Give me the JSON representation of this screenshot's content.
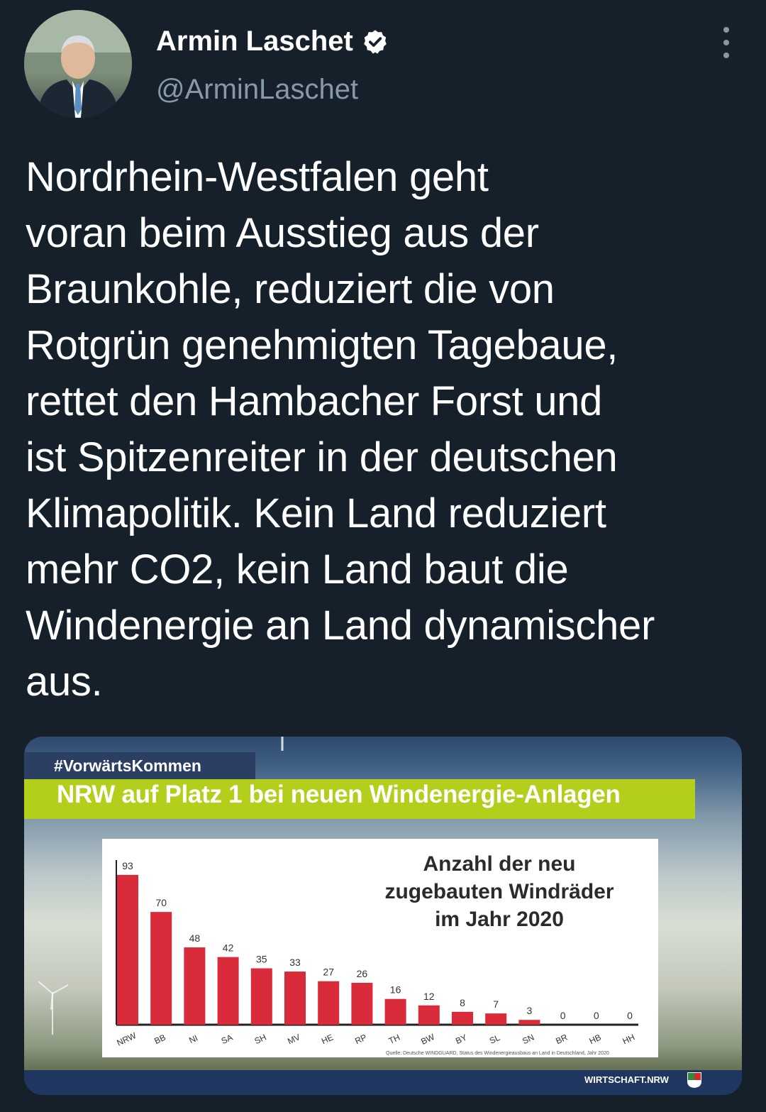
{
  "header": {
    "name": "Armin Laschet",
    "handle": "@ArminLaschet",
    "verified_icon": "verified-badge-icon",
    "more_icon": "more-vertical-icon"
  },
  "tweet": {
    "text": "Nordrhein-Westfalen geht\nvoran beim Ausstieg aus der\nBraunkohle, reduziert die von\nRotgrün genehmigten Tagebaue,\nrettet den Hambacher Forst und\nist Spitzenreiter in der deutschen\nKlimapolitik. Kein Land reduziert\nmehr CO2, kein Land baut die\nWindenergie an Land dynamischer\naus."
  },
  "media": {
    "hashtag": "#VorwärtsKommen",
    "headline": "NRW auf Platz 1 bei neuen Windenergie-Anlagen",
    "footer": "WIRTSCHAFT.NRW",
    "source": "Quelle: Deutsche WINDGUARD, Status des Windenergieausbaus an Land in Deutschland, Jahr 2020",
    "colors": {
      "bar": "#d92b3a",
      "green_band": "#b3cf1c",
      "navy": "#1f3760"
    }
  },
  "chart_data": {
    "type": "bar",
    "title": "Anzahl der neu\nzugebauten Windräder\nim Jahr 2020",
    "categories": [
      "NRW",
      "BB",
      "NI",
      "SA",
      "SH",
      "MV",
      "HE",
      "RP",
      "TH",
      "BW",
      "BY",
      "SL",
      "SN",
      "BR",
      "HB",
      "HH"
    ],
    "values": [
      93,
      70,
      48,
      42,
      35,
      33,
      27,
      26,
      16,
      12,
      8,
      7,
      3,
      0,
      0,
      0
    ],
    "ylim": [
      0,
      100
    ],
    "xlabel": "",
    "ylabel": ""
  }
}
